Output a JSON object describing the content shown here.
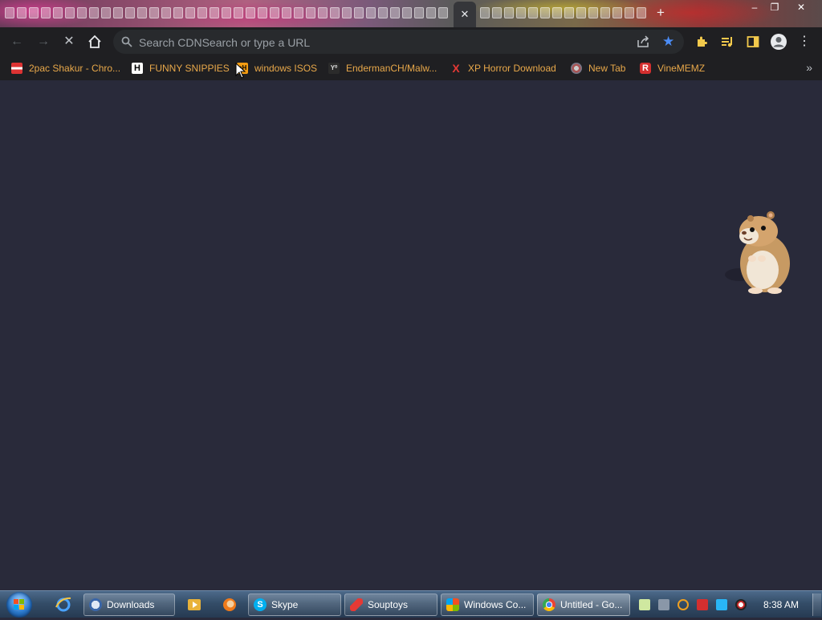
{
  "browser": {
    "omnibox_placeholder": "Search CDNSearch or type a URL",
    "active_tab_close": "✕",
    "new_tab": "+",
    "window_controls": [
      "–",
      "❐",
      "✕"
    ],
    "bookmarks": [
      {
        "label": "2pac Shakur - Chro...",
        "icon": "rose-favicon"
      },
      {
        "label": "FUNNY SNIPPIES",
        "icon": "h-favicon",
        "glyph": "H"
      },
      {
        "label": "windows ISOS",
        "icon": "nh-favicon",
        "glyph": "nH"
      },
      {
        "label": "EndermanCH/Malw...",
        "icon": "yp-favicon",
        "glyph": "Y⁰"
      },
      {
        "label": "XP Horror Download",
        "icon": "x-favicon",
        "glyph": "X"
      },
      {
        "label": "New Tab",
        "icon": "globe-favicon"
      },
      {
        "label": "VineMEMZ",
        "icon": "r-favicon",
        "glyph": "R"
      }
    ],
    "bookmarks_overflow": "»",
    "accent_color": "#4b8cf5",
    "content_background": "#292a3a"
  },
  "taskbar": {
    "buttons": [
      {
        "label": "Downloads"
      },
      {
        "label": "Skype"
      },
      {
        "label": "Souptoys"
      },
      {
        "label": "Windows Co..."
      },
      {
        "label": "Untitled - Go..."
      }
    ],
    "clock": "8:38 AM"
  }
}
